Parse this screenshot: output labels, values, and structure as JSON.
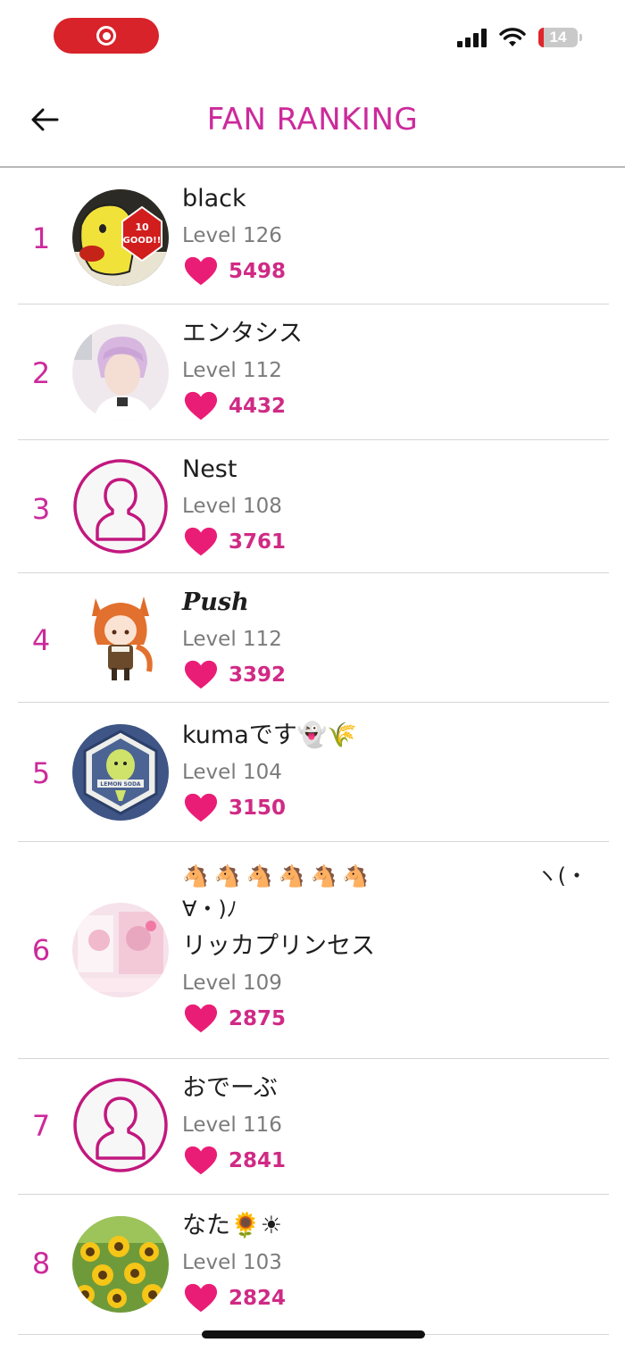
{
  "status_bar": {
    "battery_level": "14",
    "battery_fraction": 0.14
  },
  "header": {
    "title": "FAN RANKING"
  },
  "colors": {
    "accent": "#cc2a9b",
    "heart": "#e91e72",
    "count": "#d02a85",
    "record": "#d8232a"
  },
  "entries": [
    {
      "rank": "1",
      "name": "black",
      "level": "Level 126",
      "likes": "5498",
      "avatar": "cartoon-bird-good-sign"
    },
    {
      "rank": "2",
      "name": "エンタシス",
      "level": "Level 112",
      "likes": "4432",
      "avatar": "person-pink-hair"
    },
    {
      "rank": "3",
      "name": "Nest",
      "level": "Level 108",
      "likes": "3761",
      "avatar": "default-user-icon"
    },
    {
      "rank": "4",
      "name": "Push",
      "level": "Level 112",
      "likes": "3392",
      "avatar": "anime-horse-girl"
    },
    {
      "rank": "5",
      "name": "kumaです👻🌾",
      "level": "Level 104",
      "likes": "3150",
      "avatar": "lemon-badge"
    },
    {
      "rank": "6",
      "name_emoji": "🐴🐴🐴🐴🐴🐴",
      "name_kaomoji_start": "ヽ(・",
      "name_kaomoji_end": "∀・)ﾉ",
      "name": "リッカプリンセス",
      "level": "Level 109",
      "likes": "2875",
      "avatar": "pink-photo"
    },
    {
      "rank": "7",
      "name": "おでーぶ",
      "level": "Level 116",
      "likes": "2841",
      "avatar": "default-user-icon"
    },
    {
      "rank": "8",
      "name": "なた🌻☀",
      "level": "Level 103",
      "likes": "2824",
      "avatar": "sunflowers"
    }
  ]
}
